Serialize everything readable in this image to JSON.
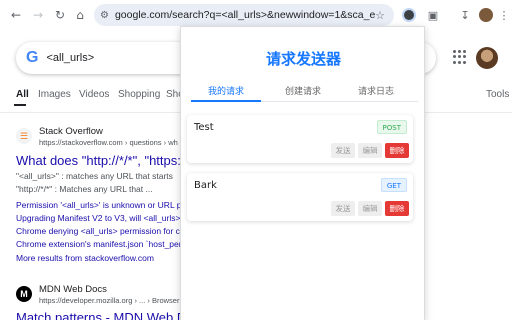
{
  "browser": {
    "url": "google.com/search?q=<all_urls>&newwindow=1&sca_esv="
  },
  "google": {
    "logo": "G",
    "query": "<all_urls>",
    "tabs": [
      "All",
      "Images",
      "Videos",
      "Shopping",
      "Sho"
    ],
    "tools": "Tools",
    "results": [
      {
        "site": "Stack Overflow",
        "url": "https://stackoverflow.com › questions › wh",
        "title": "What does \"http://*/*\", \"https://*",
        "snippet1": "\"<all_urls>\" : matches any URL that starts",
        "snippet2": "\"http://*/*\" : Matches any URL that ...",
        "links": [
          "Permission '<all_urls>' is unknown or URL p",
          "Upgrading Manifest V2 to V3, will <all_urls>",
          "Chrome denying <all_urls> permission for c",
          "Chrome extension's manifest.json `host_per"
        ],
        "more": "More results from stackoverflow.com"
      },
      {
        "site": "MDN Web Docs",
        "url": "https://developer.mozilla.org › ... › Browser e",
        "title": "Match patterns - MDN Web Do"
      }
    ]
  },
  "popup": {
    "title": "请求发送器",
    "tabs": [
      "我的请求",
      "创建请求",
      "请求日志"
    ],
    "requests": [
      {
        "name": "Test",
        "method": "POST"
      },
      {
        "name": "Bark",
        "method": "GET"
      }
    ],
    "buttons": {
      "send": "发送",
      "edit": "编辑",
      "delete": "删除"
    }
  },
  "colors": {
    "accent": "#1677ff",
    "danger": "#e53935",
    "link": "#1a0dab"
  }
}
